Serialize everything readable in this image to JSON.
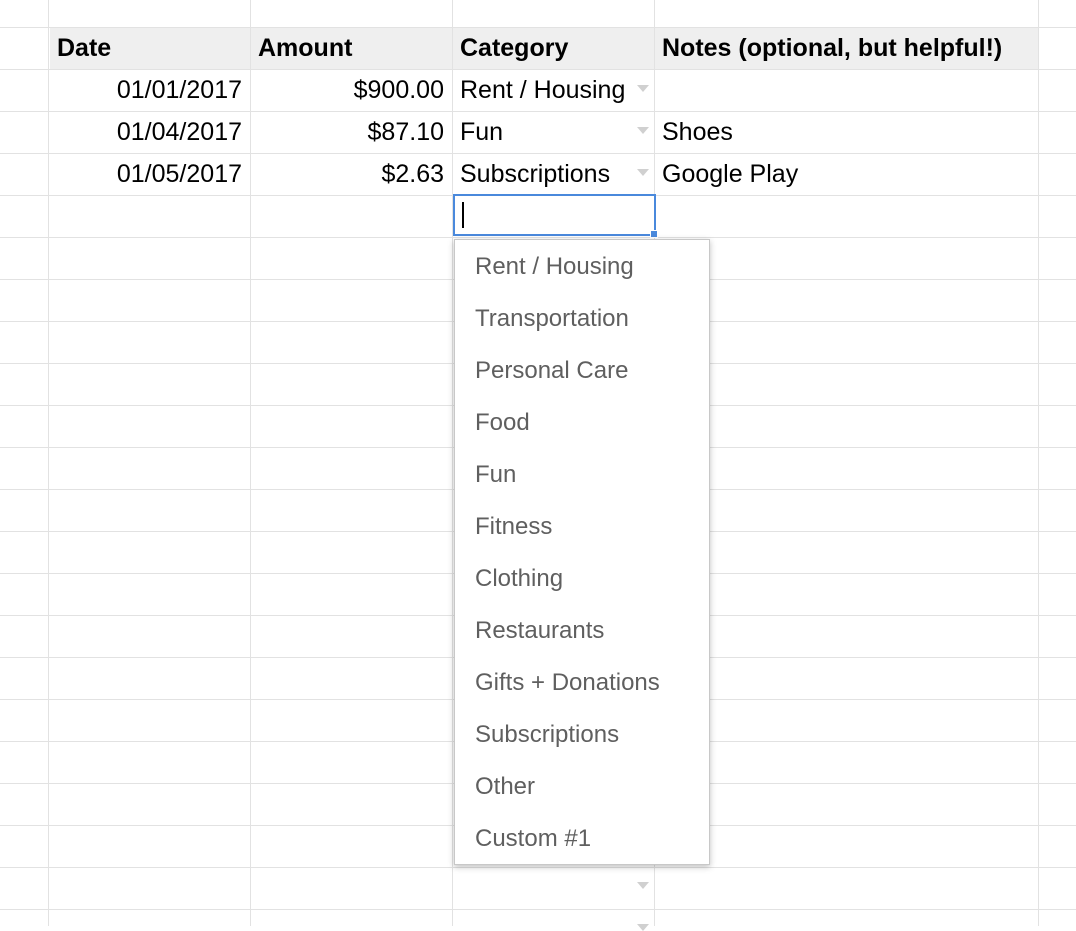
{
  "sheet": {
    "headers": {
      "date": "Date",
      "amount": "Amount",
      "category": "Category",
      "notes": "Notes (optional, but helpful!)"
    },
    "rows": [
      {
        "date": "01/01/2017",
        "amount": "$900.00",
        "category": "Rent / Housing",
        "notes": ""
      },
      {
        "date": "01/04/2017",
        "amount": "$87.10",
        "category": "Fun",
        "notes": "Shoes"
      },
      {
        "date": "01/05/2017",
        "amount": "$2.63",
        "category": "Subscriptions",
        "notes": "Google Play"
      }
    ],
    "editing_value": ""
  },
  "dropdown": {
    "options": [
      "Rent / Housing",
      "Transportation",
      "Personal Care",
      "Food",
      "Fun",
      "Fitness",
      "Clothing",
      "Restaurants",
      "Gifts + Donations",
      "Subscriptions",
      "Other",
      "Custom #1"
    ]
  },
  "icons": {
    "dropdown_arrow": "chevron-down-icon"
  },
  "colors": {
    "header_bg": "#efefef",
    "grid_line": "#e2e2e2",
    "selection_border": "#4a89dc",
    "option_text": "#5f5f5f"
  }
}
